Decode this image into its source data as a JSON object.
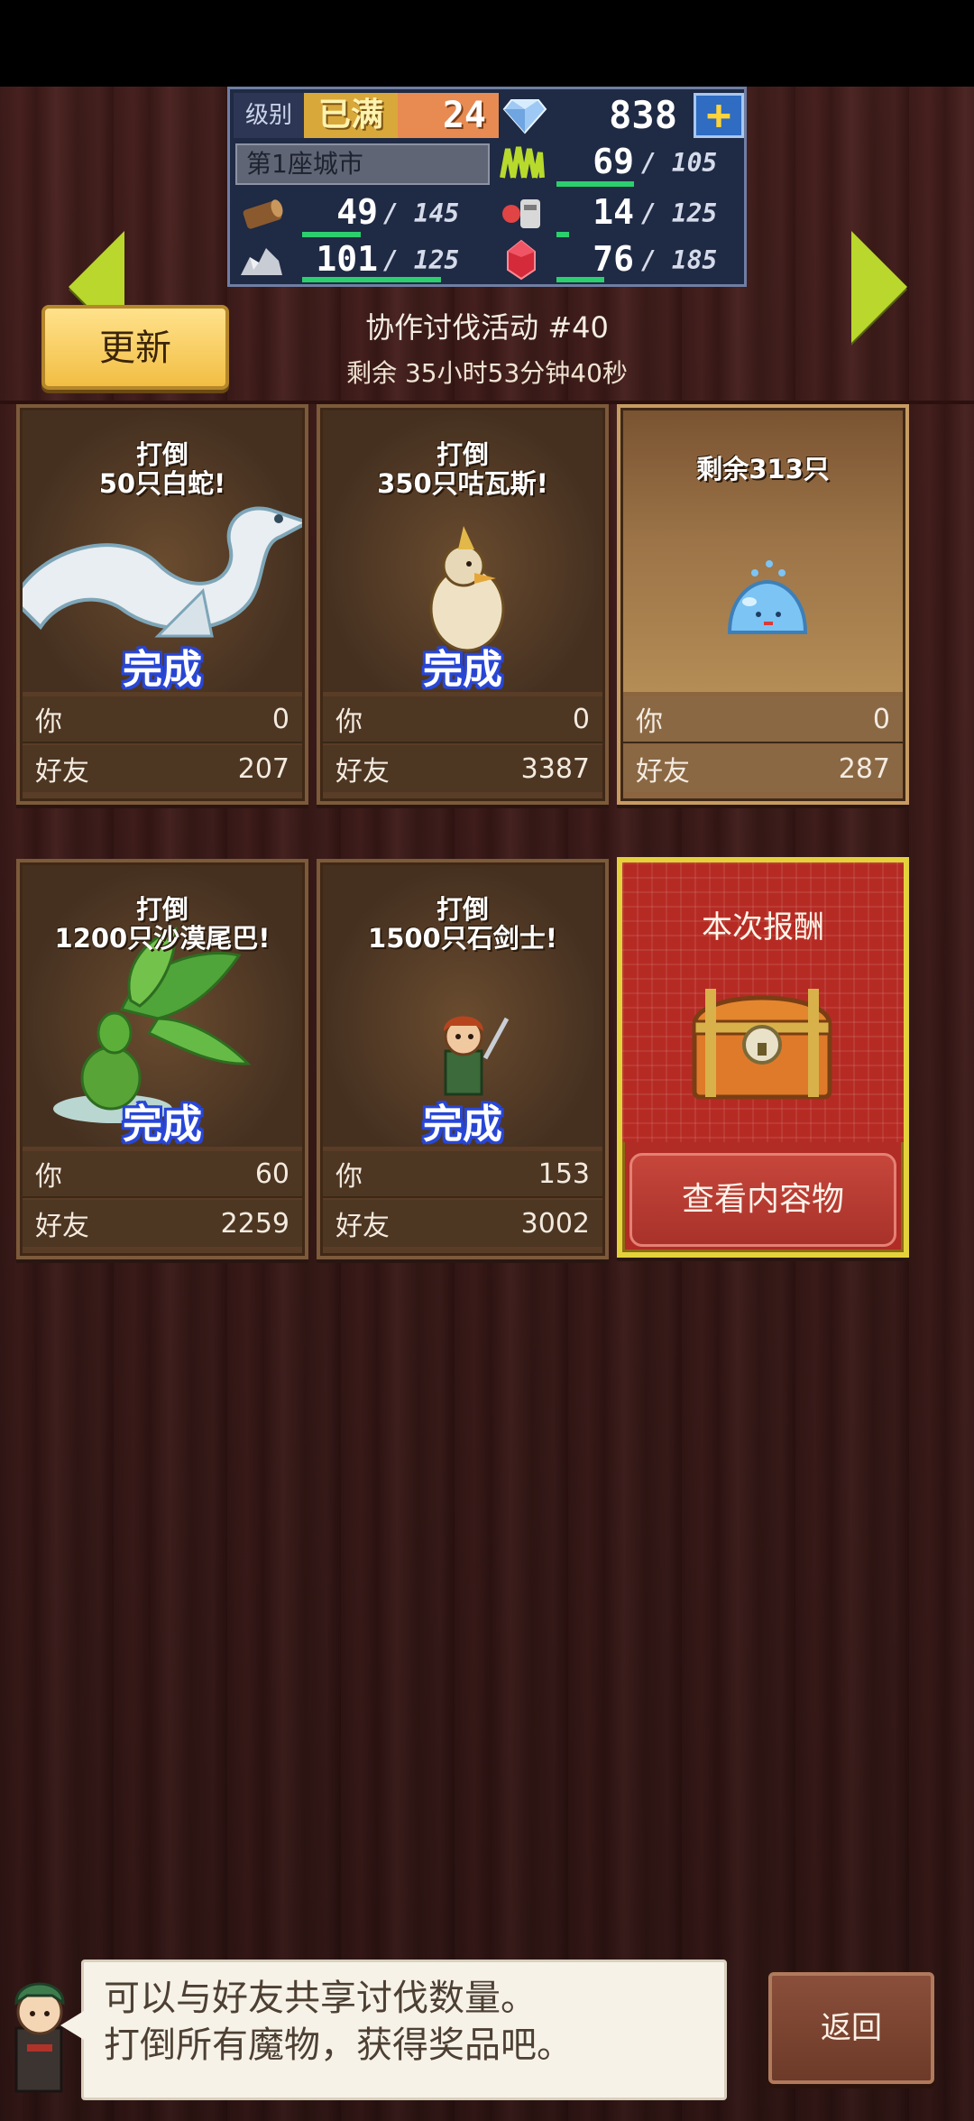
{
  "stats": {
    "level_label": "级别",
    "level_max_badge": "已满",
    "level": "24",
    "gems": "838",
    "plus_label": "+",
    "city_name": "第1座城市",
    "wood": {
      "value": "49",
      "max": "/ 145",
      "fill": 0.34
    },
    "grass": {
      "value": "69",
      "max": "/ 105",
      "fill": 0.66
    },
    "food": {
      "value": "14",
      "max": "/ 125",
      "fill": 0.11
    },
    "ore": {
      "value": "101",
      "max": "/ 125",
      "fill": 0.81
    },
    "ruby": {
      "value": "76",
      "max": "/ 185",
      "fill": 0.41
    }
  },
  "header": {
    "refresh_label": "更新",
    "event_title": "协作讨伐活动 #40",
    "time_remaining": "剩余 35小时53分钟40秒"
  },
  "cards": [
    {
      "task": "打倒\n50只白蛇!",
      "status": "完成",
      "you_label": "你",
      "you_value": "0",
      "friend_label": "好友",
      "friend_value": "207"
    },
    {
      "task": "打倒\n350只咕瓦斯!",
      "status": "完成",
      "you_label": "你",
      "you_value": "0",
      "friend_label": "好友",
      "friend_value": "3387"
    },
    {
      "task": "剩余313只",
      "status": "",
      "you_label": "你",
      "you_value": "0",
      "friend_label": "好友",
      "friend_value": "287"
    },
    {
      "task": "打倒\n1200只沙漠尾巴!",
      "status": "完成",
      "you_label": "你",
      "you_value": "60",
      "friend_label": "好友",
      "friend_value": "2259"
    },
    {
      "task": "打倒\n1500只石剑士!",
      "status": "完成",
      "you_label": "你",
      "you_value": "153",
      "friend_label": "好友",
      "friend_value": "3002"
    }
  ],
  "reward": {
    "title": "本次报酬",
    "view_label": "查看内容物"
  },
  "footer": {
    "message_line1": "可以与好友共享讨伐数量。",
    "message_line2": "打倒所有魔物，获得奖品吧。",
    "back_label": "返回"
  },
  "colors": {
    "accent_green": "#b9d72c",
    "progress_green": "#2ccf6d",
    "complete_blue": "#2846d6",
    "reward_red": "#b02c25",
    "gold_border": "#e4d23c"
  }
}
